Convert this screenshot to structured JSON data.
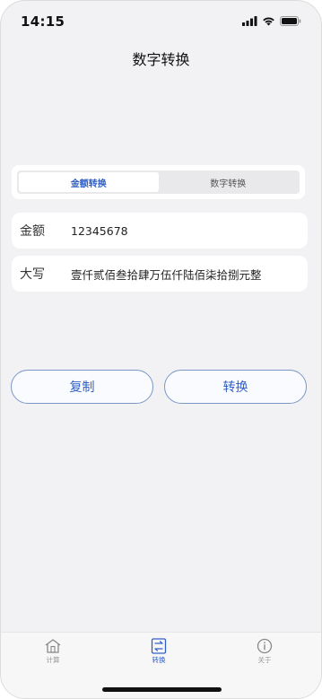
{
  "status_bar": {
    "time": "14:15"
  },
  "nav": {
    "title": "数字转换"
  },
  "segment": {
    "items": [
      {
        "label": "金额转换",
        "active": true
      },
      {
        "label": "数字转换",
        "active": false
      }
    ]
  },
  "amount_row": {
    "label": "金额",
    "value": "12345678"
  },
  "capital_row": {
    "label": "大写",
    "value": "壹仟贰佰叁拾肆万伍仟陆佰柒拾捌元整"
  },
  "buttons": {
    "copy": "复制",
    "convert": "转换"
  },
  "tabbar": {
    "items": [
      {
        "label": "计算",
        "icon": "home-icon",
        "active": false
      },
      {
        "label": "转换",
        "icon": "convert-icon",
        "active": true
      },
      {
        "label": "关于",
        "icon": "info-icon",
        "active": false
      }
    ]
  },
  "colors": {
    "accent": "#2f5fc7",
    "background": "#f2f2f4"
  }
}
